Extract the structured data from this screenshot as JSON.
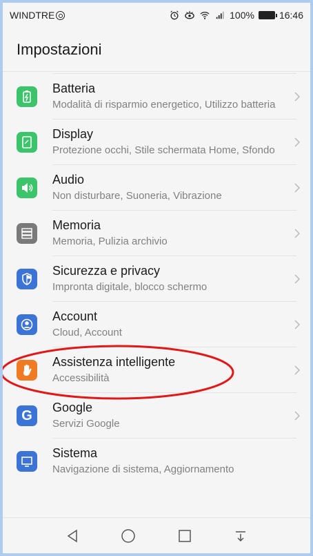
{
  "statusbar": {
    "carrier": "WINDTRE",
    "battery": "100%",
    "time": "16:46"
  },
  "header": {
    "title": "Impostazioni"
  },
  "items": [
    {
      "title": "Batteria",
      "subtitle": "Modalità di risparmio energetico, Utilizzo batteria",
      "icon": "battery-icon",
      "color": "#3cc46a"
    },
    {
      "title": "Display",
      "subtitle": "Protezione occhi, Stile schermata Home, Sfondo",
      "icon": "display-icon",
      "color": "#3cc46a"
    },
    {
      "title": "Audio",
      "subtitle": "Non disturbare, Suoneria, Vibrazione",
      "icon": "speaker-icon",
      "color": "#3cc46a"
    },
    {
      "title": "Memoria",
      "subtitle": "Memoria, Pulizia archivio",
      "icon": "storage-icon",
      "color": "#7a7a7a"
    },
    {
      "title": "Sicurezza e privacy",
      "subtitle": "Impronta digitale, blocco schermo",
      "icon": "shield-icon",
      "color": "#3b74d6"
    },
    {
      "title": "Account",
      "subtitle": "Cloud, Account",
      "icon": "account-icon",
      "color": "#3b74d6"
    },
    {
      "title": "Assistenza intelligente",
      "subtitle": "Accessibilità",
      "icon": "hand-icon",
      "color": "#f07b22"
    },
    {
      "title": "Google",
      "subtitle": "Servizi Google",
      "icon": "google-icon",
      "color": "#3b74d6"
    },
    {
      "title": "Sistema",
      "subtitle": "Navigazione di sistema, Aggiornamento",
      "icon": "system-icon",
      "color": "#3b74d6"
    }
  ],
  "navbar": {
    "back": "back-icon",
    "home": "home-icon",
    "recents": "recents-icon",
    "notifications": "notification-shade-icon"
  },
  "annotation_color": "#e01818"
}
